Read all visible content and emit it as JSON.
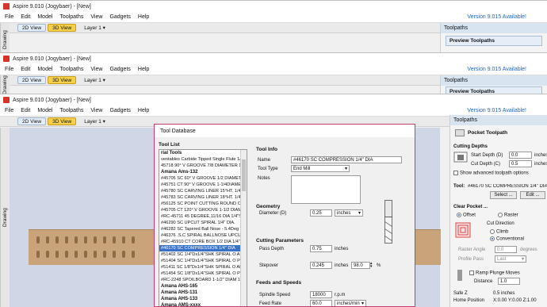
{
  "windows": [
    {
      "title": "Aspire 9.010 (Jogybaer) - [New]",
      "version_note": "Version 9.015 Available!",
      "panel_title": "Toolpaths",
      "preview_label": "Preview Toolpaths"
    },
    {
      "title": "Aspire 9.010 (Jogybaer) - [New]",
      "version_note": "Version 9.015 Available!",
      "panel_title": "Toolpaths",
      "preview_label": "Preview Toolpaths"
    },
    {
      "title": "Aspire 9.010 (Jogybaer) - [New]",
      "version_note": "Version 9.015 Available!",
      "panel_title": "Toolpaths"
    }
  ],
  "menu": [
    "File",
    "Edit",
    "Model",
    "Toolpaths",
    "View",
    "Gadgets",
    "Help"
  ],
  "toolbar": {
    "tab_2d": "2D View",
    "tab_3d": "3D View",
    "layer": "Layer 1"
  },
  "side_tab": "Drawing",
  "dialog": {
    "title": "Tool Database",
    "tool_list_label": "Tool List",
    "tools": [
      {
        "label": "rial Tools",
        "group": true
      },
      {
        "label": "ventables Carbide Tipped Single Flute 1/8th"
      },
      {
        "label": "45718 90° V GROOVE 7/8 DIAMETER 1/4\" SH"
      },
      {
        "label": "Amana Ams-132",
        "group": true
      },
      {
        "label": "#45705 SC 60° V GROOVE 1/2 DIAMETER"
      },
      {
        "label": "#45751 CT 90° V GROOVE 1-1/4DIAMET"
      },
      {
        "label": "#45780 SC CARVING LINER 15°HT. 1/4\"S"
      },
      {
        "label": "#45783 SC CARVING LINER 18°HT. 1/4\"S"
      },
      {
        "label": "#56125 SC POINT CUTTING ROUND OVE"
      },
      {
        "label": "#45705 CT 120° V GROOVE 1-1/2 DIAMET"
      },
      {
        "label": "#RC-45711 45 DEGREE,11/16 DIA 1/4\"SH"
      },
      {
        "label": "#46290 SC UPCUT SPIRAL 1/4\" DIA."
      },
      {
        "label": "#46282 SC Tapered Ball Nose - 5.4Deg T"
      },
      {
        "label": "#46376 .S.C SPIRAL BALLNOSE UPCUT 1/"
      },
      {
        "label": "#RC-45910 CT CORE BOX 1/2 DIA 1/4\"SH"
      },
      {
        "label": "#46170 SC COMPRESSION 1/4\" DIA",
        "selected": true
      },
      {
        "label": "#51402 SC 1/4\"Dx1/4\"SHK SPIRAL O ALI"
      },
      {
        "label": "#51404 SC 1/4\"Dx1/4\"SHK SPIRAL O PLA"
      },
      {
        "label": "#51411 SC 1/8\"Dx1/4\"SHK SPIRAL O ALI"
      },
      {
        "label": "#51454 SC 1/8\"Dx1/4\"SHK SPIRAL O PLA"
      },
      {
        "label": "#RC-2248 SPOILBOARD 1-1/2\" DIAM 1/4"
      },
      {
        "label": "Amana AHS-165",
        "group": true
      },
      {
        "label": "Amana AHS-131",
        "group": true
      },
      {
        "label": "Amana AHS-133",
        "group": true
      },
      {
        "label": "Amana AMS-xxxx",
        "group": true
      }
    ],
    "tool_info": {
      "section": "Tool Info",
      "name_label": "Name",
      "name_value": "#46170 SC COMPRESSION 1/4\" DIA",
      "type_label": "Tool Type",
      "type_value": "End Mill",
      "notes_label": "Notes"
    },
    "geometry": {
      "section": "Geometry",
      "diameter_label": "Diameter (D)",
      "diameter_value": "0.25",
      "diameter_unit": "inches"
    },
    "cutting": {
      "section": "Cutting Parameters",
      "pass_depth_label": "Pass Depth",
      "pass_depth_value": "0.75",
      "pass_depth_unit": "inches",
      "stepover_label": "Stepover",
      "stepover_value": "0.245",
      "stepover_unit": "inches",
      "stepover_pct": "98.0",
      "pct_sign": "%"
    },
    "feeds": {
      "section": "Feeds and Speeds",
      "spindle_label": "Spindle Speed",
      "spindle_value": "18000",
      "spindle_unit": "r.p.m",
      "feed_label": "Feed Rate",
      "feed_value": "60.0",
      "feed_unit": "inches/min"
    }
  },
  "pocket_panel": {
    "title": "Pocket Toolpath",
    "depths_header": "Cutting Depths",
    "start_label": "Start Depth (D)",
    "start_value": "0.0",
    "start_unit": "inches",
    "cut_label": "Cut Depth (C)",
    "cut_value": "0.5",
    "cut_unit": "inches",
    "advanced_label": "Show advanced toolpath options",
    "tool_label": "Tool:",
    "tool_value": "#46170 SC COMPRESSION 1/4\" DIA",
    "select_btn": "Select ...",
    "edit_btn": "Edit ...",
    "clear_header": "Clear Pocket ...",
    "offset_label": "Offset",
    "raster_label": "Raster",
    "cut_direction": "Cut Direction",
    "climb_label": "Climb",
    "conventional_label": "Conventional",
    "raster_angle_label": "Raster Angle",
    "raster_angle_value": "0.0",
    "raster_angle_unit": "degrees",
    "profile_pass_label": "Profile Pass",
    "profile_pass_value": "Last",
    "ramp_label": "Ramp Plunge Moves",
    "distance_label": "Distance",
    "distance_value": "1.0",
    "safe_z_label": "Safe Z",
    "safe_z_value": "0.5 inches",
    "home_label": "Home Position",
    "home_value": "X:0.00 Y:0.00 Z:1.00"
  },
  "colors": {
    "accent_tab": "#f7d04a",
    "link_blue": "#1f66c8",
    "dialog_border": "#c53b72",
    "selection": "#3b73c8"
  }
}
